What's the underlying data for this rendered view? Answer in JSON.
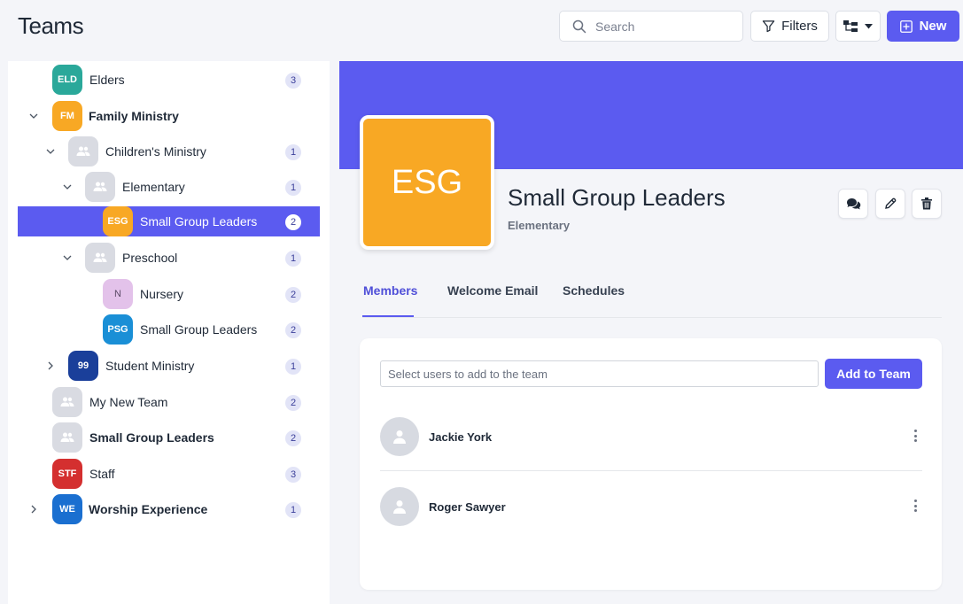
{
  "header": {
    "title": "Teams",
    "search_placeholder": "Search",
    "filters_label": "Filters",
    "new_label": "New"
  },
  "sidebar": {
    "items": [
      {
        "initials": "ELD",
        "label": "Elders",
        "count": "3",
        "color": "#2aa89a",
        "bold": false
      },
      {
        "initials": "FM",
        "label": "Family Ministry",
        "count": "",
        "color": "#f8a824",
        "bold": true
      },
      {
        "initials": "",
        "label": "Children's Ministry",
        "count": "1",
        "color": "#d9dbe2",
        "bold": false
      },
      {
        "initials": "",
        "label": "Elementary",
        "count": "1",
        "color": "#d9dbe2",
        "bold": false
      },
      {
        "initials": "ESG",
        "label": "Small Group Leaders",
        "count": "2",
        "color": "#f8a824",
        "bold": false
      },
      {
        "initials": "",
        "label": "Preschool",
        "count": "1",
        "color": "#d9dbe2",
        "bold": false
      },
      {
        "initials": "N",
        "label": "Nursery",
        "count": "2",
        "color": "#e3c2ea",
        "bold": false
      },
      {
        "initials": "PSG",
        "label": "Small Group Leaders",
        "count": "2",
        "color": "#1a8fd6",
        "bold": false
      },
      {
        "initials": "99",
        "label": "Student Ministry",
        "count": "1",
        "color": "#1a3f9a",
        "bold": false
      },
      {
        "initials": "",
        "label": "My New Team",
        "count": "2",
        "color": "#d9dbe2",
        "bold": false
      },
      {
        "initials": "",
        "label": "Small Group Leaders",
        "count": "2",
        "color": "#d9dbe2",
        "bold": true
      },
      {
        "initials": "STF",
        "label": "Staff",
        "count": "3",
        "color": "#d42f2f",
        "bold": false
      },
      {
        "initials": "WE",
        "label": "Worship Experience",
        "count": "1",
        "color": "#1a6fd0",
        "bold": true
      }
    ]
  },
  "team": {
    "initials": "ESG",
    "name": "Small Group Leaders",
    "parent": "Elementary",
    "color": "#f8a824"
  },
  "tabs": [
    "Members",
    "Welcome Email",
    "Schedules"
  ],
  "members_card": {
    "input_placeholder": "Select users to add to the team",
    "add_button": "Add to Team",
    "members": [
      "Jackie York",
      "Roger Sawyer"
    ]
  },
  "colors": {
    "accent": "#5b5bf0",
    "badge_bg": "#e2e4f7"
  }
}
